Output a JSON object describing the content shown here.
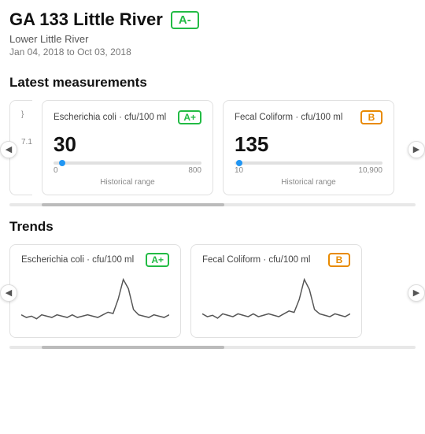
{
  "header": {
    "title": "GA 133 Little River",
    "grade": "A-",
    "grade_color": "#22bb44",
    "subtitle": "Lower Little River",
    "date_range": "Jan 04, 2018 to Oct 03, 2018"
  },
  "sections": {
    "latest": "Latest measurements",
    "trends": "Trends"
  },
  "measurements": [
    {
      "label": "Escherichia coli · cfu/100 ml",
      "grade": "A+",
      "grade_class": "grade-green",
      "value": "30",
      "dot_color": "#2196F3",
      "dot_pct": 3.5,
      "range_min": "0",
      "range_max": "800",
      "hist_label": "Historical range"
    },
    {
      "label": "Fecal Coliform · cfu/100 ml",
      "grade": "B",
      "grade_class": "grade-orange",
      "value": "135",
      "dot_color": "#2196F3",
      "dot_pct": 1.1,
      "range_min": "10",
      "range_max": "10,900",
      "hist_label": "Historical range"
    }
  ],
  "trends": [
    {
      "label": "Escherichia coli · cfu/100 ml",
      "grade": "A+",
      "grade_class": "grade-green",
      "chart_id": "ecoli"
    },
    {
      "label": "Fecal Coliform · cfu/100 ml",
      "grade": "B",
      "grade_class": "grade-orange",
      "chart_id": "fecal"
    }
  ],
  "scroll": {
    "left_arrow": "◀",
    "right_arrow": "▶"
  }
}
